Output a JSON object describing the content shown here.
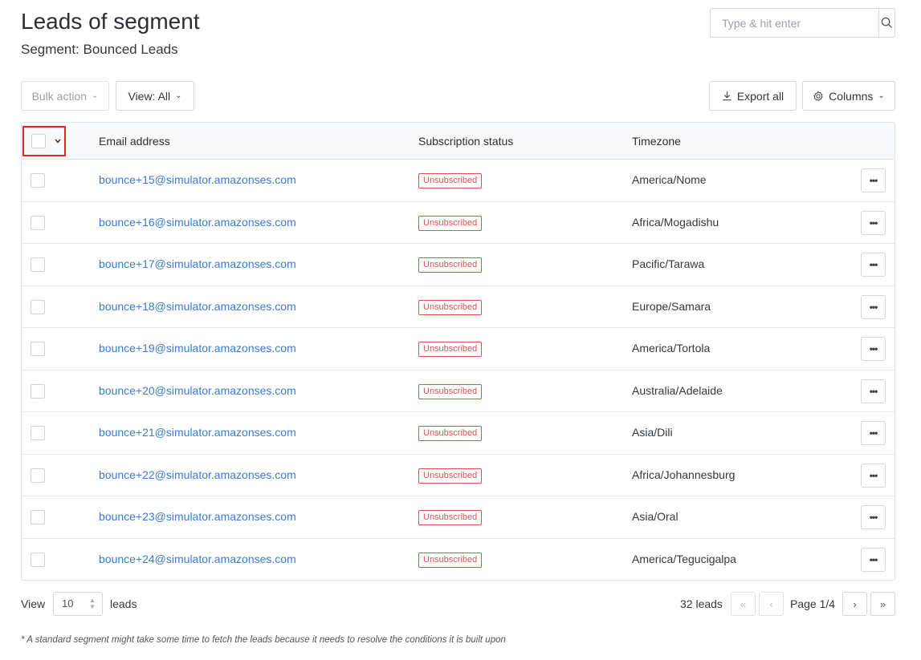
{
  "header": {
    "title": "Leads of segment",
    "subtitle": "Segment: Bounced Leads",
    "search_placeholder": "Type & hit enter"
  },
  "toolbar": {
    "bulk_action": "Bulk action",
    "view": "View: All",
    "export_all": "Export all",
    "columns": "Columns"
  },
  "table": {
    "columns": [
      "Email address",
      "Subscription status",
      "Timezone"
    ],
    "rows": [
      {
        "email": "bounce+15@simulator.amazonses.com",
        "status": "Unsubscribed",
        "timezone": "America/Nome"
      },
      {
        "email": "bounce+16@simulator.amazonses.com",
        "status": "Unsubscribed",
        "timezone": "Africa/Mogadishu"
      },
      {
        "email": "bounce+17@simulator.amazonses.com",
        "status": "Unsubscribed",
        "timezone": "Pacific/Tarawa"
      },
      {
        "email": "bounce+18@simulator.amazonses.com",
        "status": "Unsubscribed",
        "timezone": "Europe/Samara"
      },
      {
        "email": "bounce+19@simulator.amazonses.com",
        "status": "Unsubscribed",
        "timezone": "America/Tortola"
      },
      {
        "email": "bounce+20@simulator.amazonses.com",
        "status": "Unsubscribed",
        "timezone": "Australia/Adelaide"
      },
      {
        "email": "bounce+21@simulator.amazonses.com",
        "status": "Unsubscribed",
        "timezone": "Asia/Dili"
      },
      {
        "email": "bounce+22@simulator.amazonses.com",
        "status": "Unsubscribed",
        "timezone": "Africa/Johannesburg"
      },
      {
        "email": "bounce+23@simulator.amazonses.com",
        "status": "Unsubscribed",
        "timezone": "Asia/Oral"
      },
      {
        "email": "bounce+24@simulator.amazonses.com",
        "status": "Unsubscribed",
        "timezone": "America/Tegucigalpa"
      }
    ]
  },
  "footer": {
    "view_label": "View",
    "per_page": "10",
    "leads_label": "leads",
    "total": "32 leads",
    "page": "Page 1/4"
  },
  "note": "* A standard segment might take some time to fetch the leads because it needs to resolve the conditions it is built upon",
  "colors": {
    "link": "#3b7bd0",
    "danger": "#d9534f",
    "highlight": "#e3242b"
  }
}
